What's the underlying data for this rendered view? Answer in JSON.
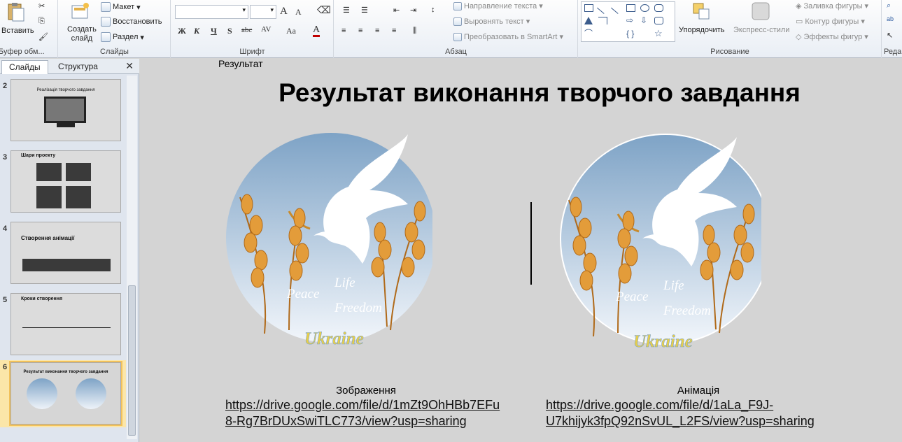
{
  "ribbon": {
    "clipboard": {
      "paste_label": "Вставить",
      "group_label": "Буфер обм..."
    },
    "slides": {
      "create_label_1": "Создать",
      "create_label_2": "слайд",
      "layout_label": "Макет",
      "reset_label": "Восстановить",
      "section_label": "Раздел",
      "group_label": "Слайды"
    },
    "font": {
      "group_label": "Шрифт",
      "grow": "A",
      "shrink": "A",
      "bold": "Ж",
      "italic": "К",
      "underline": "Ч",
      "shadow": "S",
      "strike": "abc",
      "spacing": "AV",
      "case": "Aa",
      "color": "A"
    },
    "paragraph": {
      "text_direction": "Направление текста",
      "align_text": "Выровнять текст",
      "smartart": "Преобразовать в SmartArt",
      "group_label": "Абзац"
    },
    "drawing": {
      "arrange_label": "Упорядочить",
      "quick_styles_label": "Экспресс-стили",
      "fill_label": "Заливка фигуры",
      "outline_label": "Контур фигуры",
      "effects_label": "Эффекты фигур",
      "group_label": "Рисование"
    },
    "editing": {
      "group_label": "Реда"
    }
  },
  "left_panel": {
    "tabs": [
      "Слайды",
      "Структура"
    ],
    "close_glyph": "✕",
    "thumbnails": [
      {
        "num": "2",
        "title": "Реалізація творчого завдання"
      },
      {
        "num": "3",
        "title": "Шари проекту"
      },
      {
        "num": "4",
        "title": "Створення анімації"
      },
      {
        "num": "5",
        "title": "Кроки створення"
      },
      {
        "num": "6",
        "title": "Результат виконання творчого завдання"
      }
    ]
  },
  "slide": {
    "label": "Результат",
    "title": "Результат виконання творчого завдання",
    "emblem_words": {
      "life": "Life",
      "peace": "Peace",
      "freedom": "Freedom",
      "ukraine": "Ukraine"
    },
    "left": {
      "caption": "Зображення",
      "link_line1": "https://drive.google.com/file/d/1mZt9OhHBb7EFu",
      "link_line2": "8-Rg7BrDUxSwiTLC773/view?usp=sharing"
    },
    "right": {
      "caption": "Анімація",
      "link_line1": "https://drive.google.com/file/d/1aLa_F9J-",
      "link_line2": "U7khijyk3fpQ92nSvUL_L2FS/view?usp=sharing"
    }
  },
  "colors": {
    "ribbon_bg": "#e9eef5",
    "slide_bg": "#d4d4d4",
    "emblem_top": "#7ea3c6",
    "emblem_bottom": "#f2f6fb",
    "wheat": "#e39c3a",
    "selected_thumb": "#f2c15a"
  }
}
